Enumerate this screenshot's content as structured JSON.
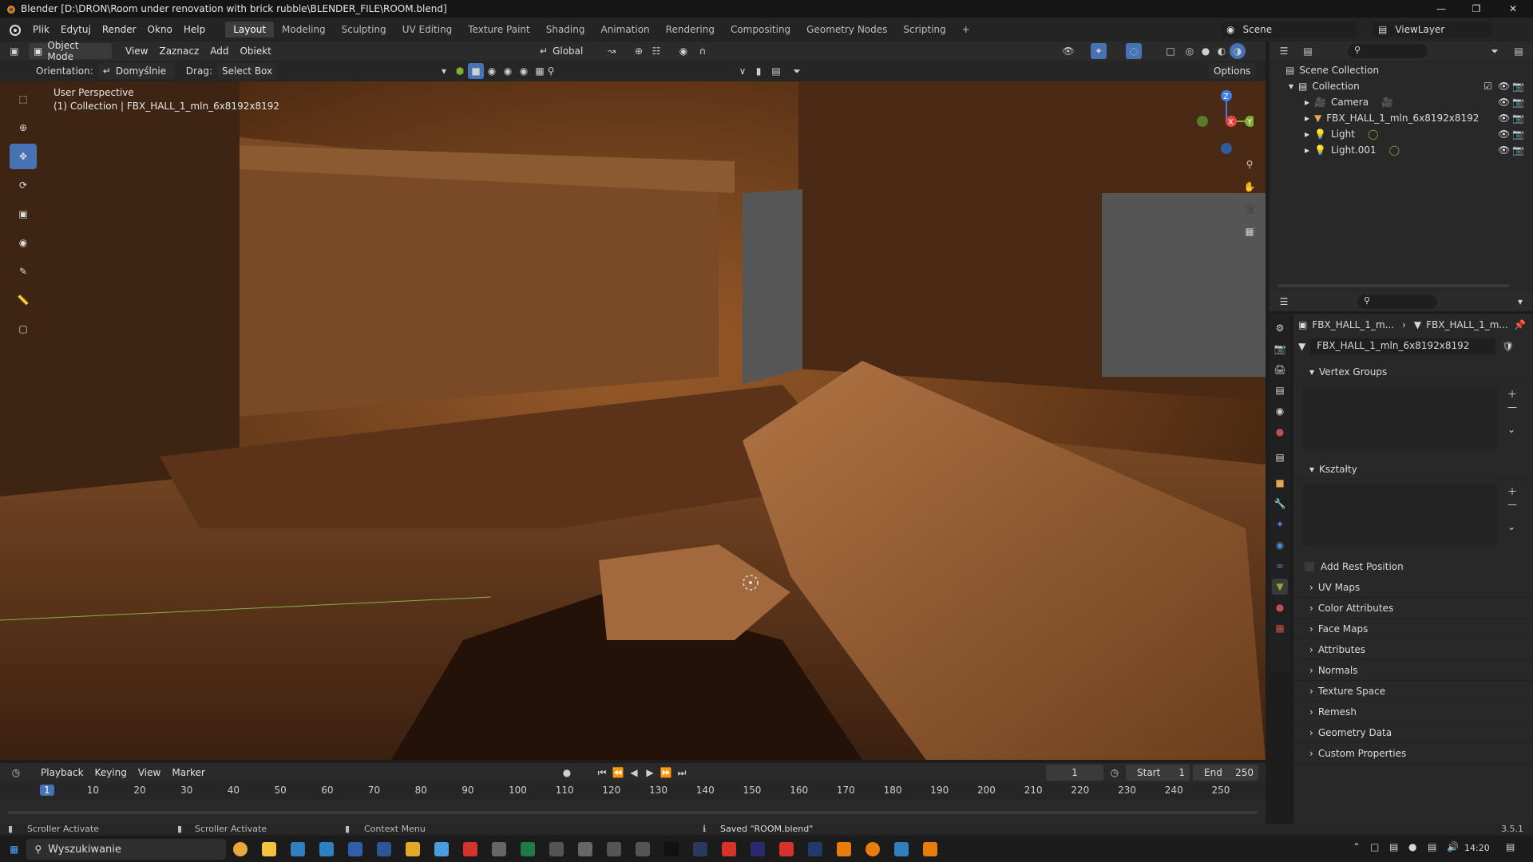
{
  "window": {
    "title": "Blender [D:\\DRON\\Room under renovation with brick rubble\\BLENDER_FILE\\ROOM.blend]",
    "minimize_icon": "minimize-icon",
    "maximize_icon": "restore-icon",
    "close_icon": "close-icon"
  },
  "menubar": {
    "menus": [
      "Plik",
      "Edytuj",
      "Render",
      "Okno",
      "Help"
    ],
    "workspaces": [
      "Layout",
      "Modeling",
      "Sculpting",
      "UV Editing",
      "Texture Paint",
      "Shading",
      "Animation",
      "Rendering",
      "Compositing",
      "Geometry Nodes",
      "Scripting"
    ],
    "active_workspace": "Layout",
    "add_tab": "+",
    "scene": "Scene",
    "view_layer": "ViewLayer"
  },
  "viewport_header": {
    "mode": "Object Mode",
    "menus": [
      "View",
      "Zaznacz",
      "Add",
      "Obiekt"
    ],
    "transform": "Global",
    "orientation_label": "Orientation:",
    "orientation_value": "Domyślnie",
    "drag_label": "Drag:",
    "drag_value": "Select Box",
    "options": "Options"
  },
  "viewport": {
    "perspective": "User Perspective",
    "collection_info": "(1) Collection | FBX_HALL_1_mln_6x8192x8192",
    "gizmo": {
      "z": "Z",
      "x": "X",
      "y": "Y"
    },
    "accent_x": "#e8433f",
    "accent_y": "#7fb032",
    "accent_z": "#3d7ee6"
  },
  "outliner": {
    "root": "Scene Collection",
    "collection": "Collection",
    "items": [
      {
        "name": "Camera",
        "icon": "camera-icon",
        "data_icon": "camera-data-icon"
      },
      {
        "name": "FBX_HALL_1_mln_6x8192x8192",
        "icon": "mesh-icon",
        "data_icon": ""
      },
      {
        "name": "Light",
        "icon": "light-icon",
        "data_icon": "light-data-icon"
      },
      {
        "name": "Light.001",
        "icon": "light-icon",
        "data_icon": "light-data-icon"
      }
    ]
  },
  "properties": {
    "breadcrumb_1": "FBX_HALL_1_m...",
    "breadcrumb_2": "FBX_HALL_1_m...",
    "mesh_name": "FBX_HALL_1_mln_6x8192x8192",
    "vertex_groups": "Vertex Groups",
    "shape_keys": "Kształty",
    "add_rest_position": "Add Rest Position",
    "collapsed_panels": [
      "UV Maps",
      "Color Attributes",
      "Face Maps",
      "Attributes",
      "Normals",
      "Texture Space",
      "Remesh",
      "Geometry Data",
      "Custom Properties"
    ]
  },
  "timeline": {
    "menus": [
      "Playback",
      "Keying",
      "View",
      "Marker"
    ],
    "current_frame": "1",
    "start_label": "Start",
    "start_value": "1",
    "end_label": "End",
    "end_value": "250",
    "ruler": [
      "1",
      "10",
      "20",
      "30",
      "40",
      "50",
      "60",
      "70",
      "80",
      "90",
      "100",
      "110",
      "120",
      "130",
      "140",
      "150",
      "160",
      "170",
      "180",
      "190",
      "200",
      "210",
      "220",
      "230",
      "240",
      "250"
    ]
  },
  "statusbar": {
    "left_1": "Scroller Activate",
    "left_2": "Scroller Activate",
    "left_3": "Context Menu",
    "message": "Saved \"ROOM.blend\"",
    "version": "3.5.1"
  },
  "taskbar": {
    "search_placeholder": "Wyszukiwanie",
    "time": "14:20"
  }
}
